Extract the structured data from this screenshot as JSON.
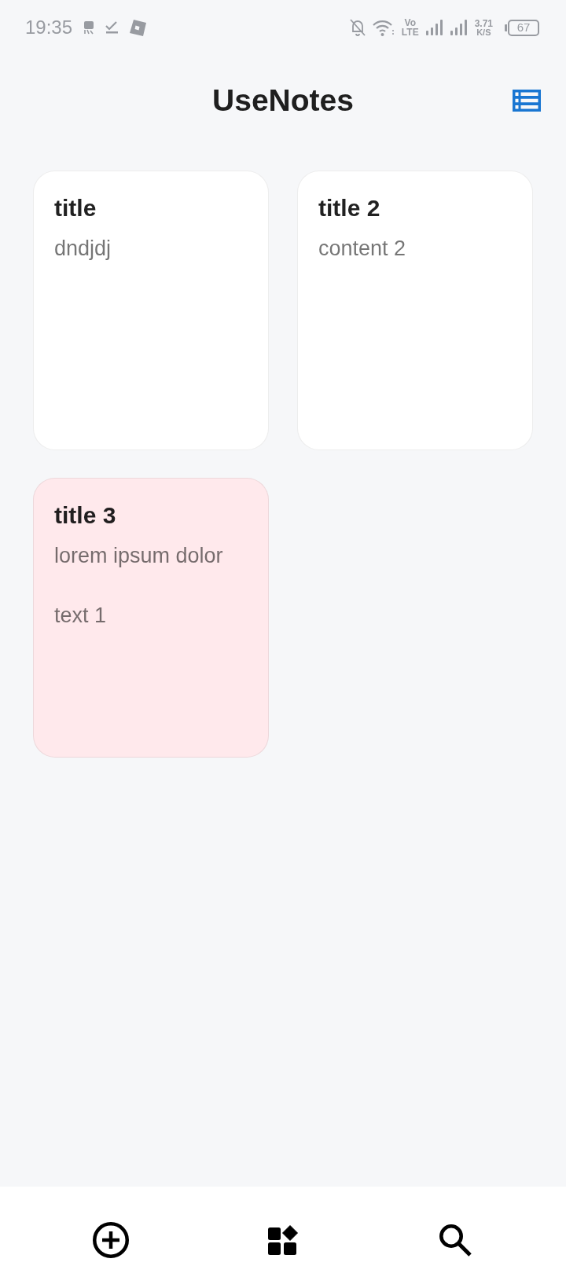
{
  "status_bar": {
    "time": "19:35",
    "volte": [
      "Vo",
      "LTE"
    ],
    "network_speed": {
      "value": "3.71",
      "unit": "K/S"
    },
    "battery": "67"
  },
  "header": {
    "title": "UseNotes"
  },
  "notes": [
    {
      "title": "title",
      "content": "dndjdj",
      "color": "#ffffff"
    },
    {
      "title": "title 2",
      "content": "content 2",
      "color": "#ffffff"
    },
    {
      "title": "title 3",
      "content": "lorem ipsum dolor\n\ntext 1",
      "color": "#ffe9ec"
    }
  ],
  "bottom_nav": [
    {
      "kind": "add"
    },
    {
      "kind": "categories"
    },
    {
      "kind": "search"
    }
  ]
}
